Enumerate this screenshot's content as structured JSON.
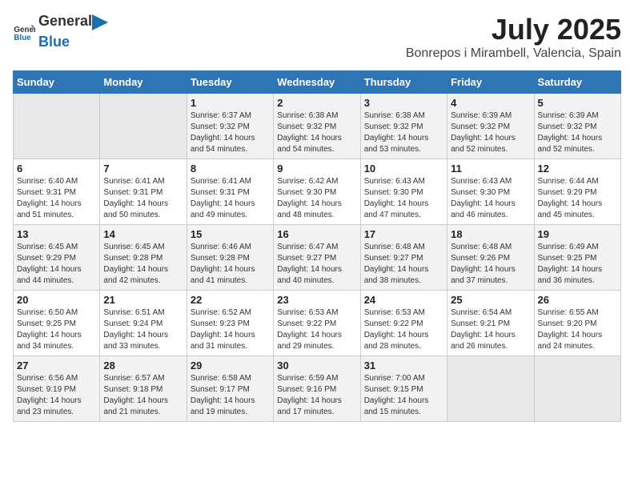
{
  "logo": {
    "general": "General",
    "blue": "Blue"
  },
  "title": "July 2025",
  "subtitle": "Bonrepos i Mirambell, Valencia, Spain",
  "weekdays": [
    "Sunday",
    "Monday",
    "Tuesday",
    "Wednesday",
    "Thursday",
    "Friday",
    "Saturday"
  ],
  "weeks": [
    [
      {
        "day": "",
        "sunrise": "",
        "sunset": "",
        "daylight": ""
      },
      {
        "day": "",
        "sunrise": "",
        "sunset": "",
        "daylight": ""
      },
      {
        "day": "1",
        "sunrise": "Sunrise: 6:37 AM",
        "sunset": "Sunset: 9:32 PM",
        "daylight": "Daylight: 14 hours and 54 minutes."
      },
      {
        "day": "2",
        "sunrise": "Sunrise: 6:38 AM",
        "sunset": "Sunset: 9:32 PM",
        "daylight": "Daylight: 14 hours and 54 minutes."
      },
      {
        "day": "3",
        "sunrise": "Sunrise: 6:38 AM",
        "sunset": "Sunset: 9:32 PM",
        "daylight": "Daylight: 14 hours and 53 minutes."
      },
      {
        "day": "4",
        "sunrise": "Sunrise: 6:39 AM",
        "sunset": "Sunset: 9:32 PM",
        "daylight": "Daylight: 14 hours and 52 minutes."
      },
      {
        "day": "5",
        "sunrise": "Sunrise: 6:39 AM",
        "sunset": "Sunset: 9:32 PM",
        "daylight": "Daylight: 14 hours and 52 minutes."
      }
    ],
    [
      {
        "day": "6",
        "sunrise": "Sunrise: 6:40 AM",
        "sunset": "Sunset: 9:31 PM",
        "daylight": "Daylight: 14 hours and 51 minutes."
      },
      {
        "day": "7",
        "sunrise": "Sunrise: 6:41 AM",
        "sunset": "Sunset: 9:31 PM",
        "daylight": "Daylight: 14 hours and 50 minutes."
      },
      {
        "day": "8",
        "sunrise": "Sunrise: 6:41 AM",
        "sunset": "Sunset: 9:31 PM",
        "daylight": "Daylight: 14 hours and 49 minutes."
      },
      {
        "day": "9",
        "sunrise": "Sunrise: 6:42 AM",
        "sunset": "Sunset: 9:30 PM",
        "daylight": "Daylight: 14 hours and 48 minutes."
      },
      {
        "day": "10",
        "sunrise": "Sunrise: 6:43 AM",
        "sunset": "Sunset: 9:30 PM",
        "daylight": "Daylight: 14 hours and 47 minutes."
      },
      {
        "day": "11",
        "sunrise": "Sunrise: 6:43 AM",
        "sunset": "Sunset: 9:30 PM",
        "daylight": "Daylight: 14 hours and 46 minutes."
      },
      {
        "day": "12",
        "sunrise": "Sunrise: 6:44 AM",
        "sunset": "Sunset: 9:29 PM",
        "daylight": "Daylight: 14 hours and 45 minutes."
      }
    ],
    [
      {
        "day": "13",
        "sunrise": "Sunrise: 6:45 AM",
        "sunset": "Sunset: 9:29 PM",
        "daylight": "Daylight: 14 hours and 44 minutes."
      },
      {
        "day": "14",
        "sunrise": "Sunrise: 6:45 AM",
        "sunset": "Sunset: 9:28 PM",
        "daylight": "Daylight: 14 hours and 42 minutes."
      },
      {
        "day": "15",
        "sunrise": "Sunrise: 6:46 AM",
        "sunset": "Sunset: 9:28 PM",
        "daylight": "Daylight: 14 hours and 41 minutes."
      },
      {
        "day": "16",
        "sunrise": "Sunrise: 6:47 AM",
        "sunset": "Sunset: 9:27 PM",
        "daylight": "Daylight: 14 hours and 40 minutes."
      },
      {
        "day": "17",
        "sunrise": "Sunrise: 6:48 AM",
        "sunset": "Sunset: 9:27 PM",
        "daylight": "Daylight: 14 hours and 38 minutes."
      },
      {
        "day": "18",
        "sunrise": "Sunrise: 6:48 AM",
        "sunset": "Sunset: 9:26 PM",
        "daylight": "Daylight: 14 hours and 37 minutes."
      },
      {
        "day": "19",
        "sunrise": "Sunrise: 6:49 AM",
        "sunset": "Sunset: 9:25 PM",
        "daylight": "Daylight: 14 hours and 36 minutes."
      }
    ],
    [
      {
        "day": "20",
        "sunrise": "Sunrise: 6:50 AM",
        "sunset": "Sunset: 9:25 PM",
        "daylight": "Daylight: 14 hours and 34 minutes."
      },
      {
        "day": "21",
        "sunrise": "Sunrise: 6:51 AM",
        "sunset": "Sunset: 9:24 PM",
        "daylight": "Daylight: 14 hours and 33 minutes."
      },
      {
        "day": "22",
        "sunrise": "Sunrise: 6:52 AM",
        "sunset": "Sunset: 9:23 PM",
        "daylight": "Daylight: 14 hours and 31 minutes."
      },
      {
        "day": "23",
        "sunrise": "Sunrise: 6:53 AM",
        "sunset": "Sunset: 9:22 PM",
        "daylight": "Daylight: 14 hours and 29 minutes."
      },
      {
        "day": "24",
        "sunrise": "Sunrise: 6:53 AM",
        "sunset": "Sunset: 9:22 PM",
        "daylight": "Daylight: 14 hours and 28 minutes."
      },
      {
        "day": "25",
        "sunrise": "Sunrise: 6:54 AM",
        "sunset": "Sunset: 9:21 PM",
        "daylight": "Daylight: 14 hours and 26 minutes."
      },
      {
        "day": "26",
        "sunrise": "Sunrise: 6:55 AM",
        "sunset": "Sunset: 9:20 PM",
        "daylight": "Daylight: 14 hours and 24 minutes."
      }
    ],
    [
      {
        "day": "27",
        "sunrise": "Sunrise: 6:56 AM",
        "sunset": "Sunset: 9:19 PM",
        "daylight": "Daylight: 14 hours and 23 minutes."
      },
      {
        "day": "28",
        "sunrise": "Sunrise: 6:57 AM",
        "sunset": "Sunset: 9:18 PM",
        "daylight": "Daylight: 14 hours and 21 minutes."
      },
      {
        "day": "29",
        "sunrise": "Sunrise: 6:58 AM",
        "sunset": "Sunset: 9:17 PM",
        "daylight": "Daylight: 14 hours and 19 minutes."
      },
      {
        "day": "30",
        "sunrise": "Sunrise: 6:59 AM",
        "sunset": "Sunset: 9:16 PM",
        "daylight": "Daylight: 14 hours and 17 minutes."
      },
      {
        "day": "31",
        "sunrise": "Sunrise: 7:00 AM",
        "sunset": "Sunset: 9:15 PM",
        "daylight": "Daylight: 14 hours and 15 minutes."
      },
      {
        "day": "",
        "sunrise": "",
        "sunset": "",
        "daylight": ""
      },
      {
        "day": "",
        "sunrise": "",
        "sunset": "",
        "daylight": ""
      }
    ]
  ]
}
